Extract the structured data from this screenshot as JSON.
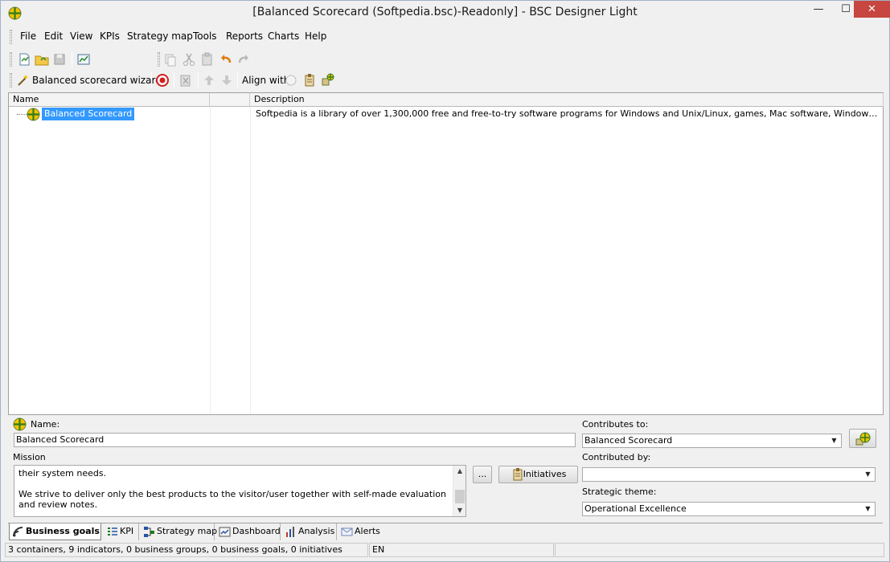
{
  "window": {
    "title": "[Balanced Scorecard (Softpedia.bsc)-Readonly] - BSC Designer Light",
    "minimize": "—",
    "maximize": "☐",
    "close": "✕"
  },
  "menu": [
    "File",
    "Edit",
    "View",
    "KPIs",
    "Strategy map",
    "Tools",
    "Reports",
    "Charts",
    "Help"
  ],
  "toolbar2": {
    "wizard_label": "Balanced scorecard wizard",
    "align_label": "Align with:"
  },
  "grid": {
    "columns": [
      "Name",
      "Description"
    ],
    "rows": [
      {
        "name": "Balanced Scorecard",
        "description": "Softpedia is a library of over 1,300,000 free and free-to-try software programs for Windows and Unix/Linux, games, Mac software, Windows drivers, mobile d..."
      }
    ]
  },
  "panel": {
    "name_label": "Name:",
    "name_value": "Balanced Scorecard",
    "mission_label": "Mission",
    "mission_text": "their system needs.\n\nWe strive to deliver only the best products to the visitor/user together with self-made evaluation and review notes.",
    "ellipsis_button": "...",
    "initiatives_button": "Initiatives",
    "contributes_label": "Contributes to:",
    "contributes_value": "Balanced Scorecard",
    "contributed_by_label": "Contributed by:",
    "contributed_by_value": "",
    "theme_label": "Strategic theme:",
    "theme_value": "Operational Excellence"
  },
  "tabs": [
    {
      "label": "Business goals",
      "icon": "business-goals-icon",
      "active": true
    },
    {
      "label": "KPI",
      "icon": "kpi-icon",
      "active": false
    },
    {
      "label": "Strategy map",
      "icon": "strategy-map-icon",
      "active": false
    },
    {
      "label": "Dashboard",
      "icon": "dashboard-icon",
      "active": false
    },
    {
      "label": "Analysis",
      "icon": "analysis-icon",
      "active": false
    },
    {
      "label": "Alerts",
      "icon": "alerts-icon",
      "active": false
    }
  ],
  "status": {
    "summary": "3 containers, 9 indicators, 0 business groups, 0 business goals, 0 initiatives",
    "language": "EN"
  },
  "colors": {
    "selection": "#3399ff",
    "close_button": "#c7463f",
    "goal_icon_green": "#3c9a2e",
    "goal_icon_yellow": "#f2c200"
  }
}
